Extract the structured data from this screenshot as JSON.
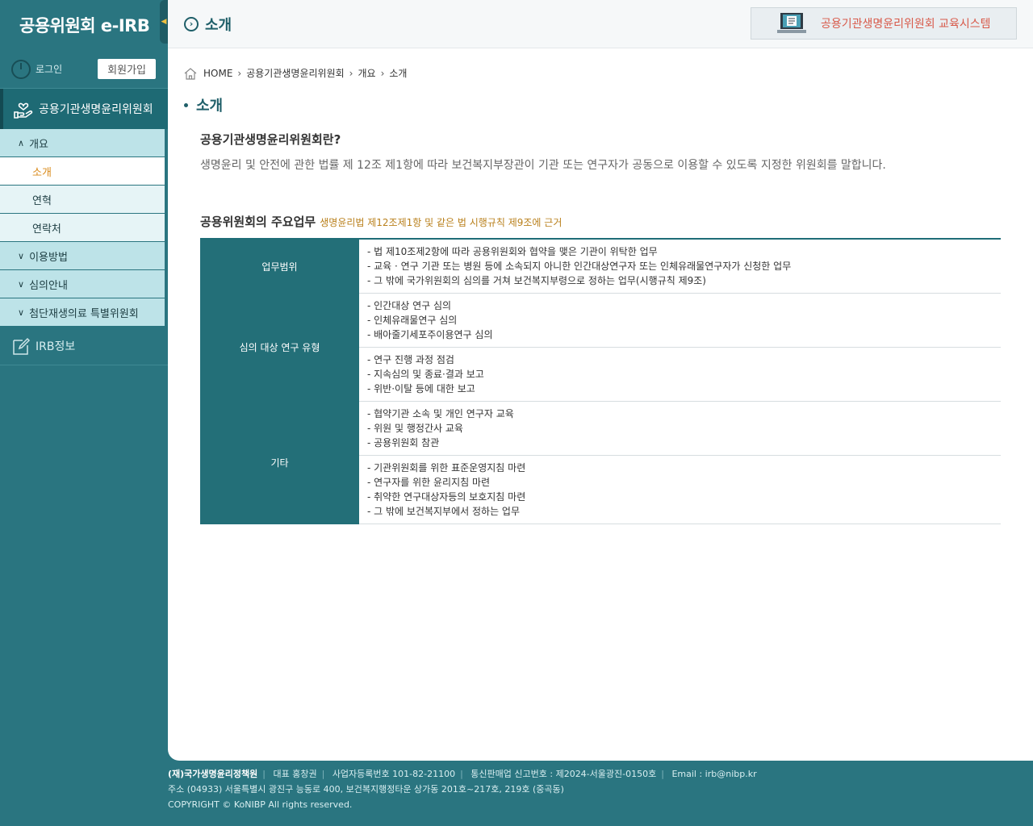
{
  "sidebar": {
    "brand": "공용위원회 e-IRB",
    "login": "로그인",
    "join": "회원가입",
    "menu_title": "공용기관생명윤리위원회",
    "groups": [
      {
        "label": "개요",
        "expanded": true,
        "children": [
          "소개",
          "연혁",
          "연락처"
        ]
      },
      {
        "label": "이용방법"
      },
      {
        "label": "심의안내"
      },
      {
        "label": "첨단재생의료 특별위원회"
      }
    ],
    "irb_info": "IRB정보"
  },
  "header": {
    "title": "소개",
    "edu_banner": "공용기관생명윤리위원회 교육시스템"
  },
  "breadcrumb": [
    "HOME",
    "공용기관생명윤리위원회",
    "개요",
    "소개"
  ],
  "page": {
    "title": "소개",
    "question": "공용기관생명윤리위원회란?",
    "description": "생명윤리 및 안전에 관한 법률 제 12조 제1항에 따라 보건복지부장관이 기관 또는 연구자가 공동으로 이용할 수 있도록 지정한 위원회를 말합니다.",
    "duty_title": "공용위원회의 주요업무",
    "duty_note": "생명윤리법 제12조제1항 및 같은 법 시행규칙 제9조에 근거"
  },
  "table": {
    "headers": [
      "업무범위",
      "심의 대상 연구 유형",
      "기타"
    ],
    "rows": [
      [
        "- 법 제10조제2항에 따라 공용위원회와 협약을 맺은 기관이 위탁한 업무",
        "- 교육 · 연구 기관 또는 병원 등에 소속되지 아니한 인간대상연구자 또는 인체유래물연구자가 신청한 업무",
        "- 그 밖에 국가위원회의 심의를 거쳐 보건복지부령으로 정하는 업무(시행규칙 제9조)"
      ],
      [
        "- 인간대상 연구 심의",
        "- 인체유래물연구 심의",
        "- 배아줄기세포주이용연구 심의"
      ],
      [
        "- 연구 진행 과정 점검",
        "- 지속심의 및 종료·결과 보고",
        "- 위반·이탈 등에 대한 보고"
      ],
      [
        "- 협약기관 소속 및 개인 연구자 교육",
        "- 위원 및 행정간사 교육",
        "- 공용위원회 참관"
      ],
      [
        "- 기관위원회를 위한 표준운영지침 마련",
        "- 연구자를 위한 윤리지침 마련",
        "- 취약한 연구대상자등의 보호지침 마련",
        "- 그 밖에 보건복지부에서 정하는 업무"
      ]
    ]
  },
  "footer": {
    "org": "(재)국가생명윤리정책원",
    "ceo": "대표 홍창권",
    "biz_no": "사업자등록번호 101-82-21100",
    "mail_order": "통신판매업 신고번호 : 제2024-서울광진-0150호",
    "email": "Email : irb@nibp.kr",
    "address": "주소 (04933) 서울특별시 광진구 능동로 400, 보건복지행정타운 상가동 201호~217호, 219호 (중곡동)",
    "copyright": "COPYRIGHT © KoNIBP All rights reserved."
  }
}
